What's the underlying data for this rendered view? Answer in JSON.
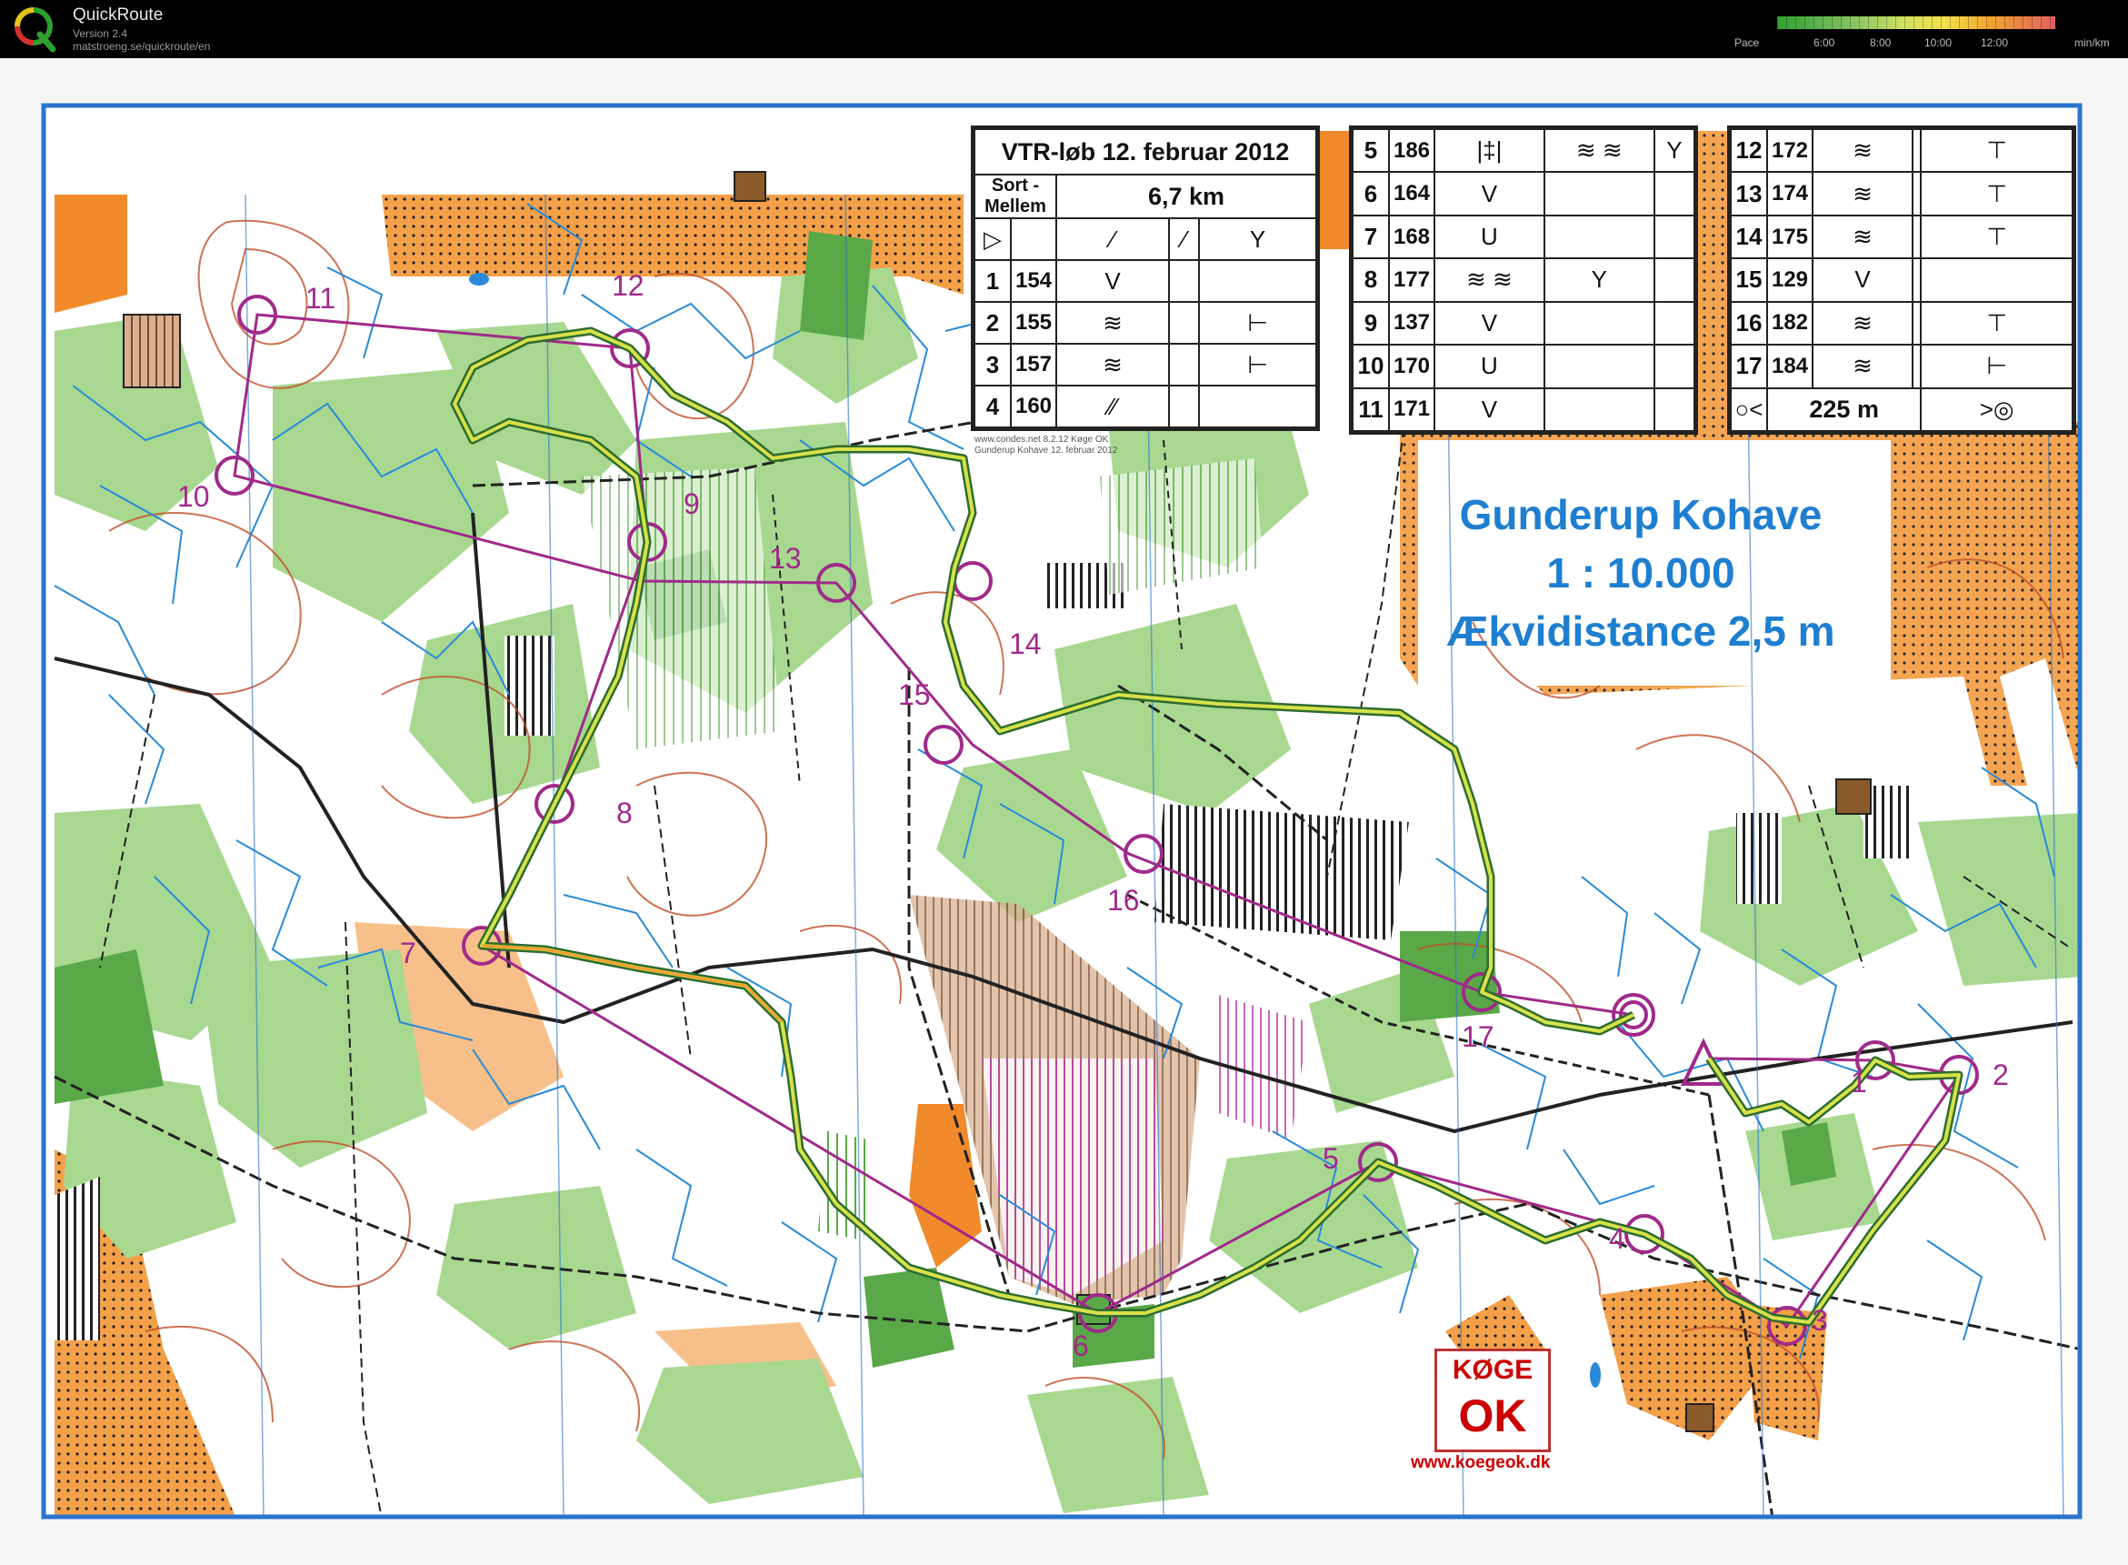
{
  "app": {
    "title": "QuickRoute",
    "version": "Version 2.4",
    "url": "matstroeng.se/quickroute/en"
  },
  "pace_legend": {
    "label": "Pace",
    "ticks": [
      "6:00",
      "8:00",
      "10:00",
      "12:00"
    ],
    "unit": "min/km",
    "gradient_colors": [
      "#2fa02f",
      "#7fc060",
      "#cfe060",
      "#f4e24a",
      "#f0a030",
      "#e06060"
    ]
  },
  "map": {
    "name": "Gunderup Kohave",
    "scale": "1 : 10.000",
    "contour": "Ækvidistance 2,5 m",
    "credit_line1": "www.condes.net 8.2.12 Køge OK",
    "credit_line2": "Gunderup Kohave 12. februar 2012",
    "club_logo_top": "KØGE",
    "club_logo_bottom": "OK",
    "club_url": "www.koegeok.dk",
    "colors": {
      "course": "#a02a8a",
      "route": "#c8dc40",
      "route_outline": "#2e6b2e",
      "border": "#2a74d0",
      "water": "#2a8ad8",
      "contour": "#c0502a",
      "forest_green": "#9fd48a",
      "dark_green": "#5aa848",
      "open_orange": "#f08a2a",
      "light_orange": "#f7c08a"
    }
  },
  "course_table": {
    "title": "VTR-løb 12. februar 2012",
    "course_name": "Sort - Mellem",
    "distance": "6,7 km",
    "start_symbols": [
      "▷",
      "⁄",
      "⁄",
      "Y"
    ],
    "finish_distance": "225 m",
    "controls": [
      {
        "num": "1",
        "code": "154",
        "sym1": "V",
        "sym2": "",
        "sym3": ""
      },
      {
        "num": "2",
        "code": "155",
        "sym1": "≋",
        "sym2": "",
        "sym3": "⊢"
      },
      {
        "num": "3",
        "code": "157",
        "sym1": "≋",
        "sym2": "",
        "sym3": "⊢"
      },
      {
        "num": "4",
        "code": "160",
        "sym1": "⁄⁄",
        "sym2": "",
        "sym3": ""
      },
      {
        "num": "5",
        "code": "186",
        "sym1": "|‡|",
        "sym2": "≋ ≋",
        "sym3": "Y"
      },
      {
        "num": "6",
        "code": "164",
        "sym1": "V",
        "sym2": "",
        "sym3": ""
      },
      {
        "num": "7",
        "code": "168",
        "sym1": "U",
        "sym2": "",
        "sym3": ""
      },
      {
        "num": "8",
        "code": "177",
        "sym1": "≋ ≋",
        "sym2": "Y",
        "sym3": ""
      },
      {
        "num": "9",
        "code": "137",
        "sym1": "V",
        "sym2": "",
        "sym3": ""
      },
      {
        "num": "10",
        "code": "170",
        "sym1": "U",
        "sym2": "",
        "sym3": ""
      },
      {
        "num": "11",
        "code": "171",
        "sym1": "V",
        "sym2": "",
        "sym3": ""
      },
      {
        "num": "12",
        "code": "172",
        "sym1": "≋",
        "sym2": "",
        "sym3": "⊤"
      },
      {
        "num": "13",
        "code": "174",
        "sym1": "≋",
        "sym2": "",
        "sym3": "⊤"
      },
      {
        "num": "14",
        "code": "175",
        "sym1": "≋",
        "sym2": "",
        "sym3": "⊤"
      },
      {
        "num": "15",
        "code": "129",
        "sym1": "V",
        "sym2": "",
        "sym3": ""
      },
      {
        "num": "16",
        "code": "182",
        "sym1": "≋",
        "sym2": "",
        "sym3": "⊤"
      },
      {
        "num": "17",
        "code": "184",
        "sym1": "≋",
        "sym2": "",
        "sym3": "⊢"
      }
    ]
  },
  "control_labels": [
    "1",
    "2",
    "3",
    "4",
    "5",
    "6",
    "7",
    "8",
    "9",
    "10",
    "11",
    "12",
    "13",
    "14",
    "15",
    "16",
    "17"
  ]
}
